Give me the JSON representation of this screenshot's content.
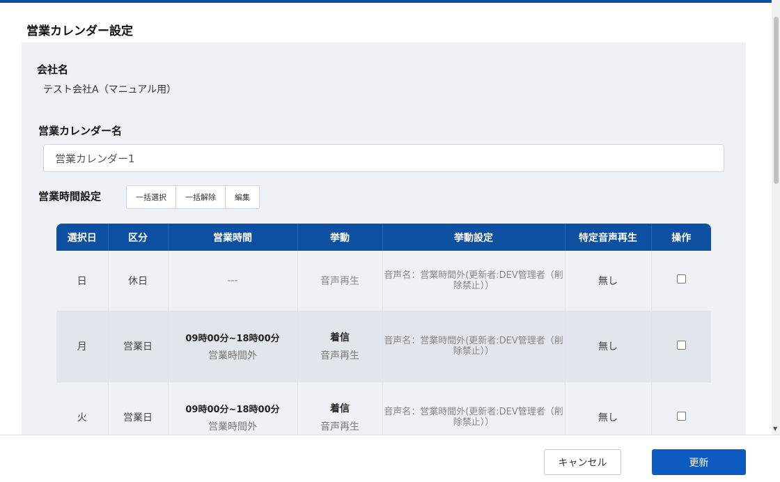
{
  "dialog": {
    "title": "営業カレンダー設定"
  },
  "company": {
    "label": "会社名",
    "value": "テスト会社A（マニュアル用）"
  },
  "calendar_name": {
    "label": "営業カレンダー名",
    "value": "営業カレンダー1"
  },
  "hours_settings": {
    "label": "営業時間設定",
    "buttons": [
      "一括選択",
      "一括解除",
      "編集"
    ]
  },
  "table": {
    "headers": [
      "選択日",
      "区分",
      "営業時間",
      "挙動",
      "挙動設定",
      "特定音声再生",
      "操作"
    ],
    "rows": [
      {
        "day": "日",
        "category": "休日",
        "hours": "---",
        "hours_sub": "",
        "behavior": "",
        "behavior_sub": "音声再生",
        "setting": "音声名：営業時間外(更新者:DEV管理者（削除禁止））",
        "specific_voice": "無し",
        "checked": false
      },
      {
        "day": "月",
        "category": "営業日",
        "hours": "09時00分~18時00分",
        "hours_sub": "営業時間外",
        "behavior": "着信",
        "behavior_sub": "音声再生",
        "setting": "音声名：営業時間外(更新者:DEV管理者（削除禁止））",
        "specific_voice": "無し",
        "checked": false
      },
      {
        "day": "火",
        "category": "営業日",
        "hours": "09時00分~18時00分",
        "hours_sub": "営業時間外",
        "behavior": "着信",
        "behavior_sub": "音声再生",
        "setting": "音声名：営業時間外(更新者:DEV管理者（削除禁止））",
        "specific_voice": "無し",
        "checked": false
      }
    ]
  },
  "footer": {
    "cancel_label": "キャンセル",
    "update_label": "更新"
  },
  "colors": {
    "brand": "#0d4fa0",
    "primary_button": "#0d5bc0",
    "panel_bg": "#eef2f7"
  }
}
